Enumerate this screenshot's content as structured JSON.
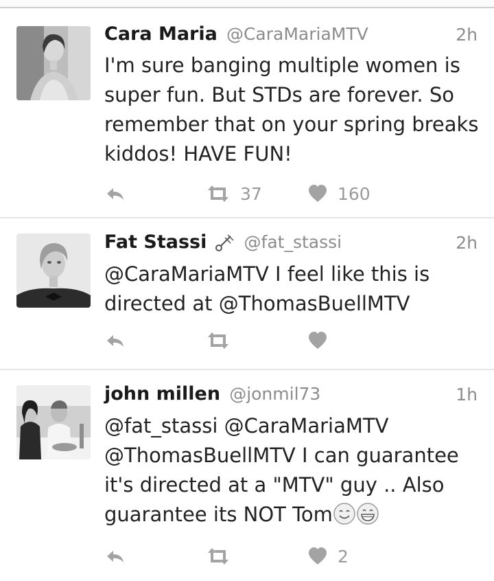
{
  "tweets": [
    {
      "name": "Cara Maria",
      "handle": "@CaraMariaMTV",
      "time": "2h",
      "text": "I'm sure  banging multiple women is super fun. But STDs are forever. So remember that on your spring breaks kiddos! HAVE FUN!",
      "retweets": "37",
      "likes": "160",
      "avatar": "woman-portrait"
    },
    {
      "name": "Fat Stassi",
      "name_icon": "sparkler-icon",
      "handle": "@fat_stassi",
      "time": "2h",
      "text": "@CaraMariaMTV I feel like this is directed at @ThomasBuellMTV",
      "retweets": "",
      "likes": "",
      "avatar": "woman-bowtie-portrait"
    },
    {
      "name": "john millen",
      "handle": "@jonmil73",
      "time": "1h",
      "text": "@fat_stassi @CaraMariaMTV @ThomasBuellMTV I can guarantee it's directed at a \"MTV\" guy .. Also guarantee its NOT Tom",
      "emojis": [
        "smiling-face-icon",
        "grinning-face-icon"
      ],
      "retweets": "",
      "likes": "2",
      "avatar": "couple-photo"
    }
  ],
  "colors": {
    "name": "#1a1a1a",
    "meta": "#8c8c8c",
    "text": "#222222",
    "action": "#a3a3a3"
  }
}
